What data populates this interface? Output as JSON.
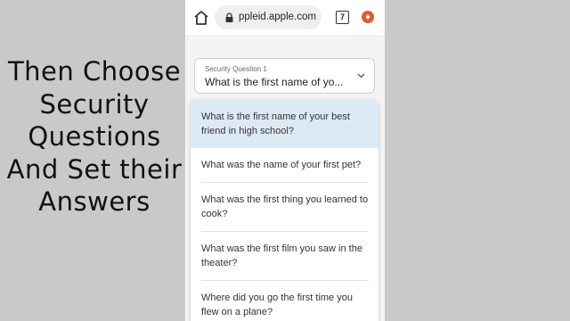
{
  "caption": {
    "lines": [
      "Then Choose",
      "Security",
      "Questions",
      "And Set their",
      "Answers"
    ]
  },
  "browser": {
    "url": "ppleid.apple.com",
    "tab_count": "7",
    "icons": [
      "home-icon",
      "lock-icon",
      "tabs-icon",
      "extension-icon"
    ]
  },
  "form": {
    "security_question_label": "Security Question 1",
    "selected_value": "What is the first name of yo...",
    "options": [
      "What is the first name of your best friend in high school?",
      "What was the name of your first pet?",
      "What was the first thing you learned to cook?",
      "What was the first film you saw in the theater?",
      "Where did you go the first time you flew on a plane?"
    ],
    "selected_index": 0
  },
  "colors": {
    "background": "#c9c9c9",
    "selected_option": "#dceaf6",
    "extension": "#e25b2f"
  }
}
